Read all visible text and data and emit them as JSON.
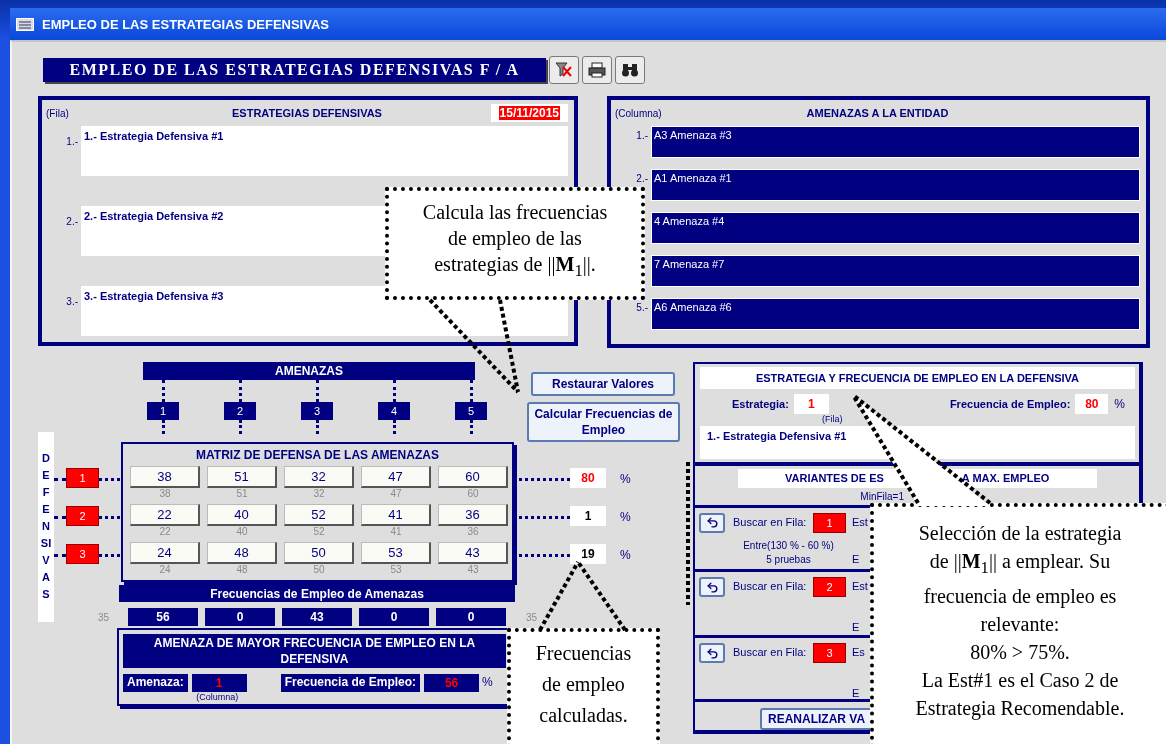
{
  "window": {
    "title": "EMPLEO DE LAS ESTRATEGIAS DEFENSIVAS"
  },
  "banner": {
    "title": "EMPLEO DE LAS ESTRATEGIAS DEFENSIVAS F / A"
  },
  "toolbar": [
    {
      "kind": "clear-filter"
    },
    {
      "kind": "print"
    },
    {
      "kind": "find"
    }
  ],
  "strategies_panel": {
    "hint": "(Fila)",
    "title": "ESTRATEGIAS DEFENSIVAS",
    "date": "15/11/2015",
    "items": [
      {
        "number": "1.-",
        "text": "1.- Estrategia Defensiva #1"
      },
      {
        "number": "2.-",
        "text": "2.- Estrategia Defensiva #2"
      },
      {
        "number": "3.-",
        "text": "3.- Estrategia Defensiva #3"
      }
    ]
  },
  "threats_panel": {
    "hint": "(Columna)",
    "title": "AMENAZAS A LA ENTIDAD",
    "items": [
      {
        "number": "1.-",
        "text": "A3 Amenaza #3"
      },
      {
        "number": "2.-",
        "text": "A1 Amenaza #1"
      },
      {
        "text": "4 Amenaza #4"
      },
      {
        "text": "7 Amenaza #7"
      },
      {
        "number": "5.-",
        "text": "A6 Amenaza #6"
      }
    ]
  },
  "matrix": {
    "header": "AMENAZAS",
    "columns": [
      "1",
      "2",
      "3",
      "4",
      "5"
    ],
    "side_label": "DEFENSIVAS",
    "title": "MATRIZ DE DEFENSA DE LAS AMENAZAS",
    "unit": "%",
    "rows": [
      {
        "label": "1",
        "cells": [
          "38",
          "51",
          "32",
          "47",
          "60"
        ],
        "shadow": [
          "38",
          "51",
          "32",
          "47",
          "60"
        ],
        "result": "80",
        "selected": true
      },
      {
        "label": "2",
        "cells": [
          "22",
          "40",
          "52",
          "41",
          "36"
        ],
        "shadow": [
          "22",
          "40",
          "52",
          "41",
          "36"
        ],
        "result": "1",
        "selected": false
      },
      {
        "label": "3",
        "cells": [
          "24",
          "48",
          "50",
          "53",
          "43"
        ],
        "shadow": [
          "24",
          "48",
          "50",
          "53",
          "43"
        ],
        "result": "19",
        "selected": false
      }
    ]
  },
  "frequencies": {
    "title": "Frecuencias de Empleo de Amenazas",
    "values": [
      "56",
      "0",
      "43",
      "0",
      "0"
    ],
    "left_note": "35",
    "right_note": "35"
  },
  "max_threat": {
    "title": "AMENAZA DE MAYOR FRECUENCIA DE EMPLEO EN LA DEFENSIVA",
    "threat_label": "Amenaza:",
    "threat": "1",
    "threat_hint": "(Columna)",
    "freq_label": "Frecuencia de Empleo:",
    "freq": "56",
    "unit": "%"
  },
  "buttons": [
    "Restaurar Valores",
    "Calcular Frecuencias de Empleo"
  ],
  "selection_panel": {
    "title": "ESTRATEGIA Y FRECUENCIA DE EMPLEO EN LA DEFENSIVA",
    "strategy_label": "Estrategia:",
    "strategy": "1",
    "strategy_hint": "(Fila)",
    "freq_label": "Frecuencia de Empleo:",
    "freq": "80",
    "unit": "%",
    "description": "1.- Estrategia Defensiva #1"
  },
  "variants": {
    "title_start": "VARIANTES DE ES",
    "title_end": "A MAX. EMPLEO",
    "min_row": "MinFila=1",
    "reanalyze": "REANALIZAR VA",
    "rows": [
      {
        "label": "Buscar en Fila:",
        "row": "1",
        "cut_top": "Est",
        "range": "Entre(130 % - 60 %)",
        "tries": "5 pruebas",
        "cut_bottom": "E"
      },
      {
        "label": "Buscar en Fila:",
        "row": "2",
        "cut_top": "Est",
        "cut_bottom": "E"
      },
      {
        "label": "Buscar en Fila:",
        "row": "3",
        "cut_top": "Es",
        "cut_bottom": "E"
      }
    ]
  },
  "callouts": [
    {
      "text": "Calcula las frecuencias\nde empleo de las\nestrategias de ||**M**$_{1}$||."
    },
    {
      "text": "Frecuencias\nde empleo\ncalculadas."
    },
    {
      "text": "Selección de la estrategia\nde ||**M**$_{1}$|| a emplear. Su\nfrecuencia de empleo es\nrelevante:\n80% > 75%.\nLa Est#1 es el Caso 2 de\nEstrategia Recomendable."
    }
  ]
}
